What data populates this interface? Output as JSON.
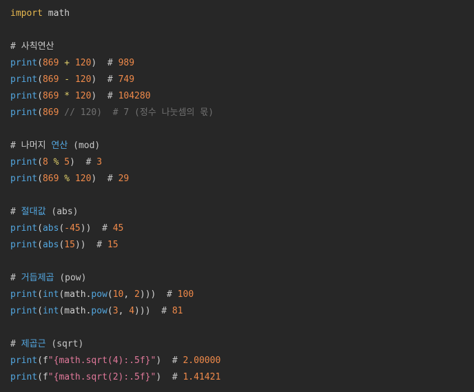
{
  "editor": {
    "background": "#272727",
    "lines": [
      [
        {
          "t": "import",
          "c": "t-kw"
        },
        {
          "t": " math",
          "c": "t-plain"
        }
      ],
      [],
      [
        {
          "t": "# 사칙연산",
          "c": "t-cmt"
        }
      ],
      [
        {
          "t": "print",
          "c": "t-fn"
        },
        {
          "t": "(",
          "c": "t-plain"
        },
        {
          "t": "869",
          "c": "t-num"
        },
        {
          "t": " + ",
          "c": "t-op"
        },
        {
          "t": "120",
          "c": "t-num"
        },
        {
          "t": ")  ",
          "c": "t-plain"
        },
        {
          "t": "# ",
          "c": "t-cmt"
        },
        {
          "t": "989",
          "c": "t-cmtnum"
        }
      ],
      [
        {
          "t": "print",
          "c": "t-fn"
        },
        {
          "t": "(",
          "c": "t-plain"
        },
        {
          "t": "869",
          "c": "t-num"
        },
        {
          "t": " - ",
          "c": "t-op"
        },
        {
          "t": "120",
          "c": "t-num"
        },
        {
          "t": ")  ",
          "c": "t-plain"
        },
        {
          "t": "# ",
          "c": "t-cmt"
        },
        {
          "t": "749",
          "c": "t-cmtnum"
        }
      ],
      [
        {
          "t": "print",
          "c": "t-fn"
        },
        {
          "t": "(",
          "c": "t-plain"
        },
        {
          "t": "869",
          "c": "t-num"
        },
        {
          "t": " * ",
          "c": "t-op"
        },
        {
          "t": "120",
          "c": "t-num"
        },
        {
          "t": ")  ",
          "c": "t-plain"
        },
        {
          "t": "# ",
          "c": "t-cmt"
        },
        {
          "t": "104280",
          "c": "t-cmtnum"
        }
      ],
      [
        {
          "t": "print",
          "c": "t-fn"
        },
        {
          "t": "(",
          "c": "t-plain"
        },
        {
          "t": "869",
          "c": "t-num"
        },
        {
          "t": " // 120)  # 7 (정수 나눗셈의 몫)",
          "c": "t-dim"
        }
      ],
      [],
      [
        {
          "t": "# 나머지 ",
          "c": "t-cmt"
        },
        {
          "t": "연산",
          "c": "t-hl"
        },
        {
          "t": " (mod)",
          "c": "t-cmt"
        }
      ],
      [
        {
          "t": "print",
          "c": "t-fn"
        },
        {
          "t": "(",
          "c": "t-plain"
        },
        {
          "t": "8",
          "c": "t-num"
        },
        {
          "t": " % ",
          "c": "t-op"
        },
        {
          "t": "5",
          "c": "t-num"
        },
        {
          "t": ")  ",
          "c": "t-plain"
        },
        {
          "t": "# ",
          "c": "t-cmt"
        },
        {
          "t": "3",
          "c": "t-cmtnum"
        }
      ],
      [
        {
          "t": "print",
          "c": "t-fn"
        },
        {
          "t": "(",
          "c": "t-plain"
        },
        {
          "t": "869",
          "c": "t-num"
        },
        {
          "t": " % ",
          "c": "t-op"
        },
        {
          "t": "120",
          "c": "t-num"
        },
        {
          "t": ")  ",
          "c": "t-plain"
        },
        {
          "t": "# ",
          "c": "t-cmt"
        },
        {
          "t": "29",
          "c": "t-cmtnum"
        }
      ],
      [],
      [
        {
          "t": "# ",
          "c": "t-cmt"
        },
        {
          "t": "절대값",
          "c": "t-hl"
        },
        {
          "t": " (abs)",
          "c": "t-cmt"
        }
      ],
      [
        {
          "t": "print",
          "c": "t-fn"
        },
        {
          "t": "(",
          "c": "t-plain"
        },
        {
          "t": "abs",
          "c": "t-fn"
        },
        {
          "t": "(",
          "c": "t-plain"
        },
        {
          "t": "-45",
          "c": "t-num"
        },
        {
          "t": "))  ",
          "c": "t-plain"
        },
        {
          "t": "# ",
          "c": "t-cmt"
        },
        {
          "t": "45",
          "c": "t-cmtnum"
        }
      ],
      [
        {
          "t": "print",
          "c": "t-fn"
        },
        {
          "t": "(",
          "c": "t-plain"
        },
        {
          "t": "abs",
          "c": "t-fn"
        },
        {
          "t": "(",
          "c": "t-plain"
        },
        {
          "t": "15",
          "c": "t-num"
        },
        {
          "t": "))  ",
          "c": "t-plain"
        },
        {
          "t": "# ",
          "c": "t-cmt"
        },
        {
          "t": "15",
          "c": "t-cmtnum"
        }
      ],
      [],
      [
        {
          "t": "# ",
          "c": "t-cmt"
        },
        {
          "t": "거듭제곱",
          "c": "t-hl"
        },
        {
          "t": " (pow)",
          "c": "t-cmt"
        }
      ],
      [
        {
          "t": "print",
          "c": "t-fn"
        },
        {
          "t": "(",
          "c": "t-plain"
        },
        {
          "t": "int",
          "c": "t-fn"
        },
        {
          "t": "(math.",
          "c": "t-plain"
        },
        {
          "t": "pow",
          "c": "t-fn"
        },
        {
          "t": "(",
          "c": "t-plain"
        },
        {
          "t": "10",
          "c": "t-num"
        },
        {
          "t": ", ",
          "c": "t-plain"
        },
        {
          "t": "2",
          "c": "t-num"
        },
        {
          "t": ")))  ",
          "c": "t-plain"
        },
        {
          "t": "# ",
          "c": "t-cmt"
        },
        {
          "t": "100",
          "c": "t-cmtnum"
        }
      ],
      [
        {
          "t": "print",
          "c": "t-fn"
        },
        {
          "t": "(",
          "c": "t-plain"
        },
        {
          "t": "int",
          "c": "t-fn"
        },
        {
          "t": "(math.",
          "c": "t-plain"
        },
        {
          "t": "pow",
          "c": "t-fn"
        },
        {
          "t": "(",
          "c": "t-plain"
        },
        {
          "t": "3",
          "c": "t-num"
        },
        {
          "t": ", ",
          "c": "t-plain"
        },
        {
          "t": "4",
          "c": "t-num"
        },
        {
          "t": ")))  ",
          "c": "t-plain"
        },
        {
          "t": "# ",
          "c": "t-cmt"
        },
        {
          "t": "81",
          "c": "t-cmtnum"
        }
      ],
      [],
      [
        {
          "t": "# ",
          "c": "t-cmt"
        },
        {
          "t": "제곱근",
          "c": "t-hl"
        },
        {
          "t": " (sqrt)",
          "c": "t-cmt"
        }
      ],
      [
        {
          "t": "print",
          "c": "t-fn"
        },
        {
          "t": "(f",
          "c": "t-plain"
        },
        {
          "t": "\"{math.sqrt(4):.5f}\"",
          "c": "t-str"
        },
        {
          "t": ")  ",
          "c": "t-plain"
        },
        {
          "t": "# ",
          "c": "t-cmt"
        },
        {
          "t": "2.00000",
          "c": "t-cmtnum"
        }
      ],
      [
        {
          "t": "print",
          "c": "t-fn"
        },
        {
          "t": "(f",
          "c": "t-plain"
        },
        {
          "t": "\"{math.sqrt(2):.5f}\"",
          "c": "t-str"
        },
        {
          "t": ")  ",
          "c": "t-plain"
        },
        {
          "t": "# ",
          "c": "t-cmt"
        },
        {
          "t": "1.41421",
          "c": "t-cmtnum"
        }
      ]
    ]
  }
}
